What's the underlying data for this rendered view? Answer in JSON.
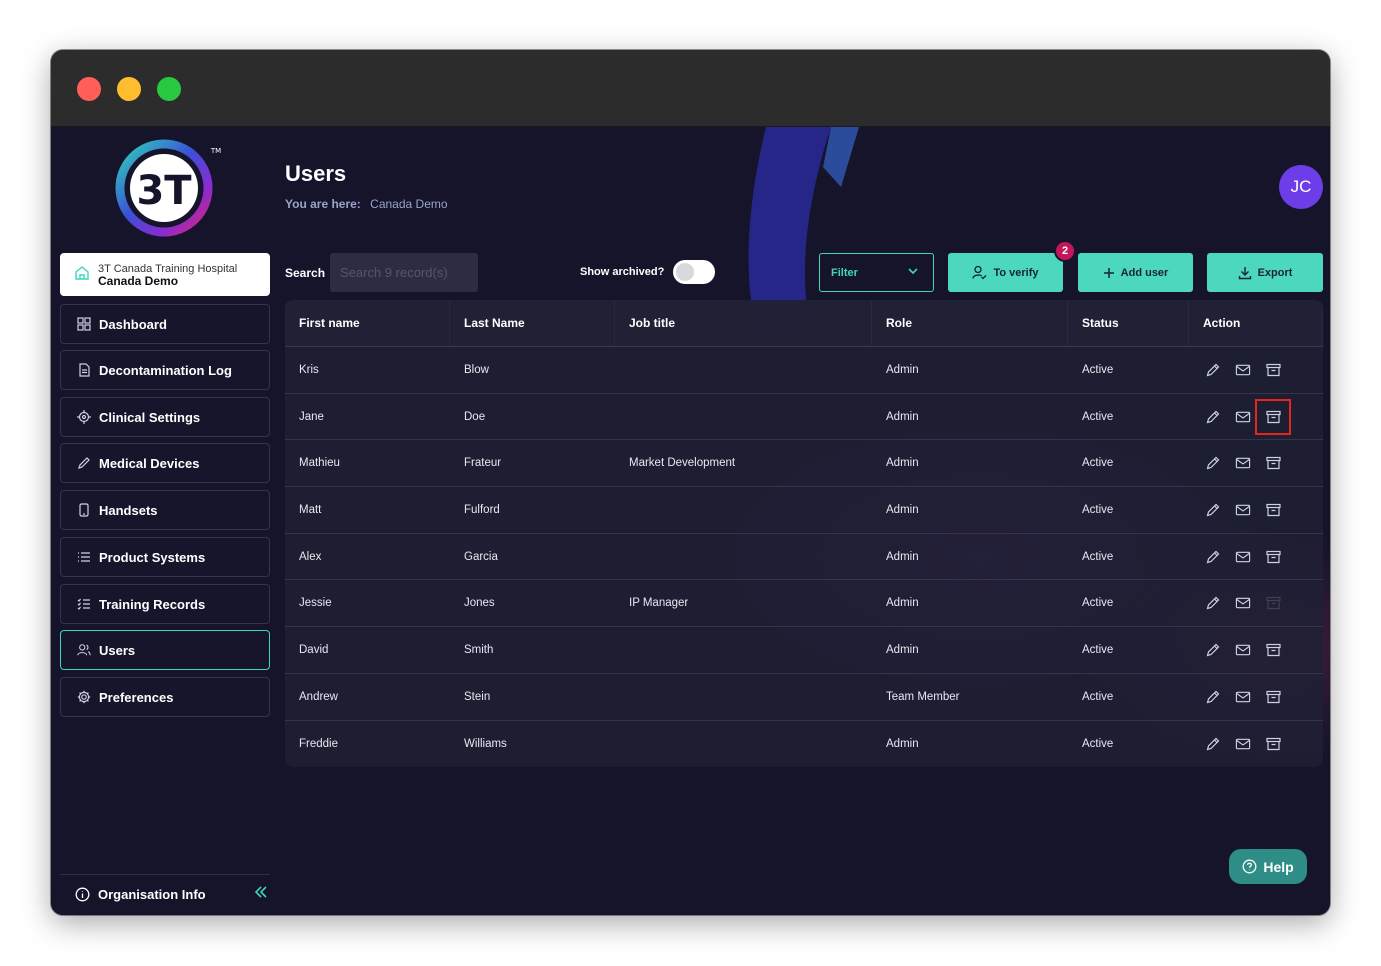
{
  "window": {
    "controls": [
      "close",
      "minimize",
      "maximize"
    ]
  },
  "brand": {
    "logo_text": "3T",
    "tm": "TM"
  },
  "org": {
    "line1": "3T Canada Training Hospital",
    "line2": "Canada Demo"
  },
  "nav": [
    {
      "label": "Dashboard",
      "icon": "grid-icon"
    },
    {
      "label": "Decontamination Log",
      "icon": "document-icon"
    },
    {
      "label": "Clinical Settings",
      "icon": "target-icon"
    },
    {
      "label": "Medical Devices",
      "icon": "pen-icon"
    },
    {
      "label": "Handsets",
      "icon": "phone-icon"
    },
    {
      "label": "Product Systems",
      "icon": "list-icon"
    },
    {
      "label": "Training Records",
      "icon": "checklist-icon"
    },
    {
      "label": "Users",
      "icon": "users-icon",
      "active": true
    },
    {
      "label": "Preferences",
      "icon": "gear-icon"
    }
  ],
  "org_info": {
    "label": "Organisation Info"
  },
  "header": {
    "title": "Users",
    "crumb_label": "You are here:",
    "crumb_value": "Canada Demo",
    "avatar": "JC"
  },
  "toolbar": {
    "search_label": "Search",
    "search_placeholder": "Search 9 record(s)",
    "archived_label": "Show archived?",
    "filter_label": "Filter",
    "verify_label": "To verify",
    "verify_badge": "2",
    "add_label": "Add user",
    "export_label": "Export"
  },
  "table": {
    "columns": [
      "First name",
      "Last Name",
      "Job title",
      "Role",
      "Status",
      "Action"
    ],
    "rows": [
      {
        "first": "Kris",
        "last": "Blow",
        "job": "",
        "role": "Admin",
        "status": "Active"
      },
      {
        "first": "Jane",
        "last": "Doe",
        "job": "",
        "role": "Admin",
        "status": "Active"
      },
      {
        "first": "Mathieu",
        "last": "Frateur",
        "job": "Market Development",
        "role": "Admin",
        "status": "Active"
      },
      {
        "first": "Matt",
        "last": "Fulford",
        "job": "",
        "role": "Admin",
        "status": "Active"
      },
      {
        "first": "Alex",
        "last": "Garcia",
        "job": "",
        "role": "Admin",
        "status": "Active"
      },
      {
        "first": "Jessie",
        "last": "Jones",
        "job": "IP Manager",
        "role": "Admin",
        "status": "Active"
      },
      {
        "first": "David",
        "last": "Smith",
        "job": "",
        "role": "Admin",
        "status": "Active"
      },
      {
        "first": "Andrew",
        "last": "Stein",
        "job": "",
        "role": "Team Member",
        "status": "Active"
      },
      {
        "first": "Freddie",
        "last": "Williams",
        "job": "",
        "role": "Admin",
        "status": "Active"
      }
    ]
  },
  "help": {
    "label": "Help"
  },
  "colors": {
    "accent": "#4bd8bf",
    "avatar": "#6d3ee8",
    "badge": "#c2185b",
    "highlight": "#e3261f",
    "background": "#15142b"
  }
}
